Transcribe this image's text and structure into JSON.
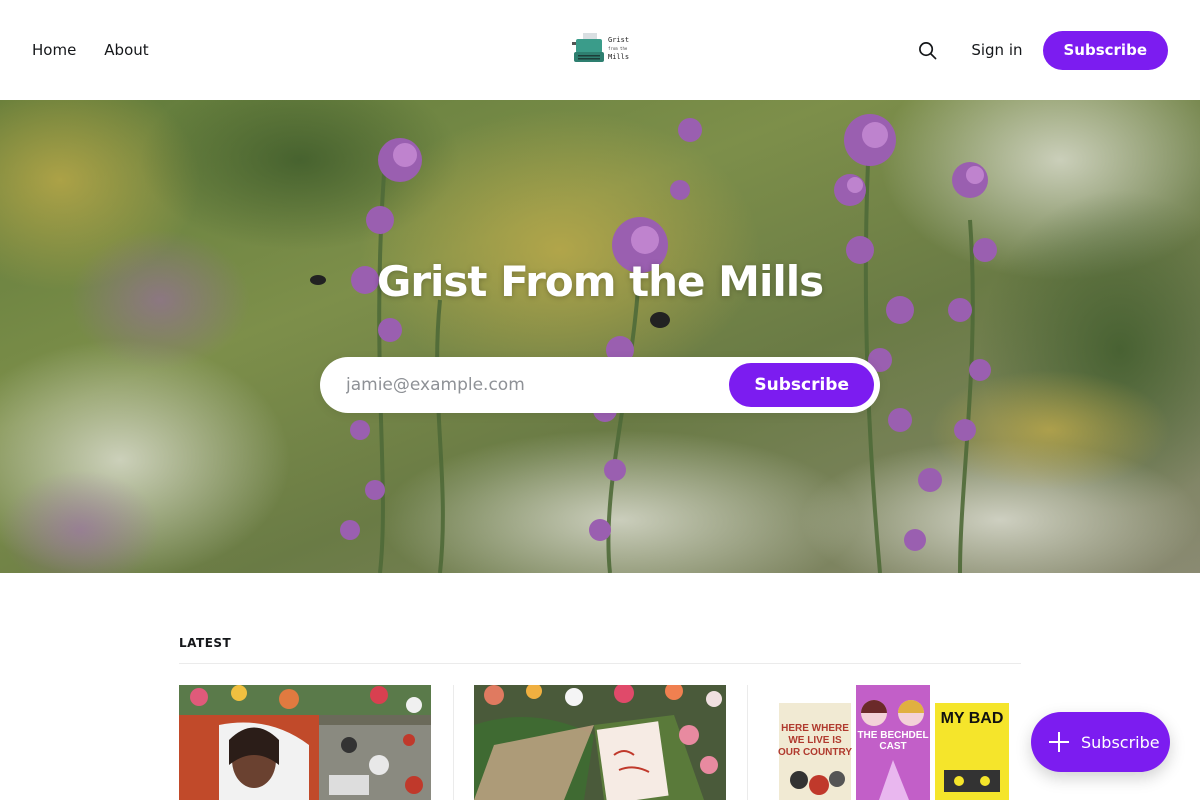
{
  "header": {
    "nav": [
      {
        "label": "Home"
      },
      {
        "label": "About"
      }
    ],
    "logo_text": [
      "Grist",
      "from the",
      "Mills"
    ],
    "search_icon": "search-icon",
    "signin_label": "Sign in",
    "subscribe_label": "Subscribe"
  },
  "hero": {
    "title": "Grist From the Mills",
    "email_placeholder": "jamie@example.com",
    "subscribe_label": "Subscribe"
  },
  "latest": {
    "label": "LATEST",
    "cards": [
      {
        "image": "memorial-flowers-angel-mural"
      },
      {
        "image": "flowers-with-note"
      },
      {
        "image": "book-covers-collage",
        "covers": [
          "HERE WHERE WE LIVE IS OUR COUNTRY",
          "THE BECHDEL CAST",
          "MY BAD"
        ]
      }
    ]
  },
  "portal": {
    "label": "Subscribe",
    "icon": "plus-icon"
  },
  "colors": {
    "accent": "#7c1cf0",
    "text": "#15171a",
    "divider": "#ebebeb"
  }
}
